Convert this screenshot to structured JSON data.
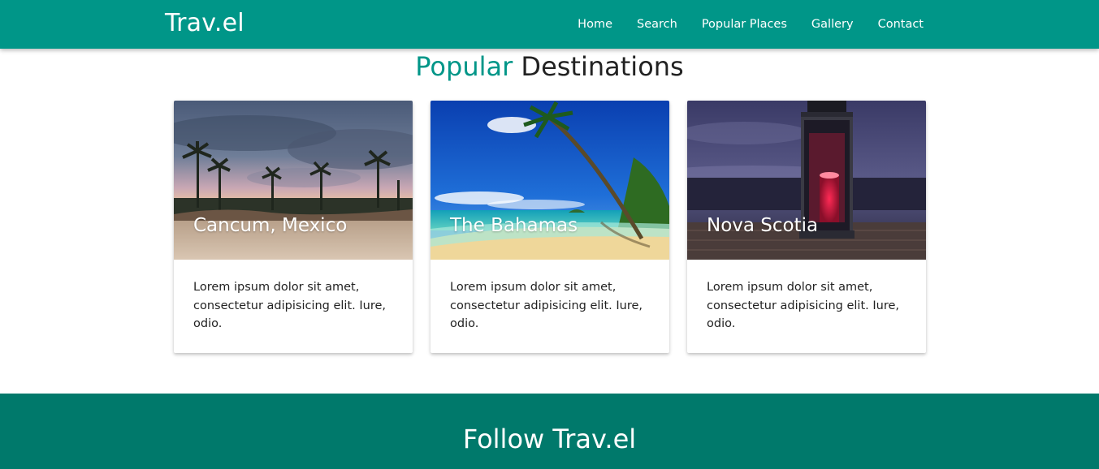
{
  "navbar": {
    "brand": "Trav.el",
    "links": [
      "Home",
      "Search",
      "Popular Places",
      "Gallery",
      "Contact"
    ],
    "background": "#009688"
  },
  "section": {
    "title_accent": "Popular",
    "title_rest": "Destinations",
    "accent_color": "#009688"
  },
  "cards": [
    {
      "title": "Cancum, Mexico",
      "image": "sunset-beach-palm-trees-photo",
      "text": "Lorem ipsum dolor sit amet, consectetur adipisicing elit. Iure, odio."
    },
    {
      "title": "The Bahamas",
      "image": "tropical-beach-leaning-palm-photo",
      "text": "Lorem ipsum dolor sit amet, consectetur adipisicing elit. Iure, odio."
    },
    {
      "title": "Nova Scotia",
      "image": "lantern-on-dock-dusk-photo",
      "text": "Lorem ipsum dolor sit amet, consectetur adipisicing elit. Iure, odio."
    }
  ],
  "follow": {
    "title": "Follow Trav.el",
    "background": "#00796b"
  }
}
